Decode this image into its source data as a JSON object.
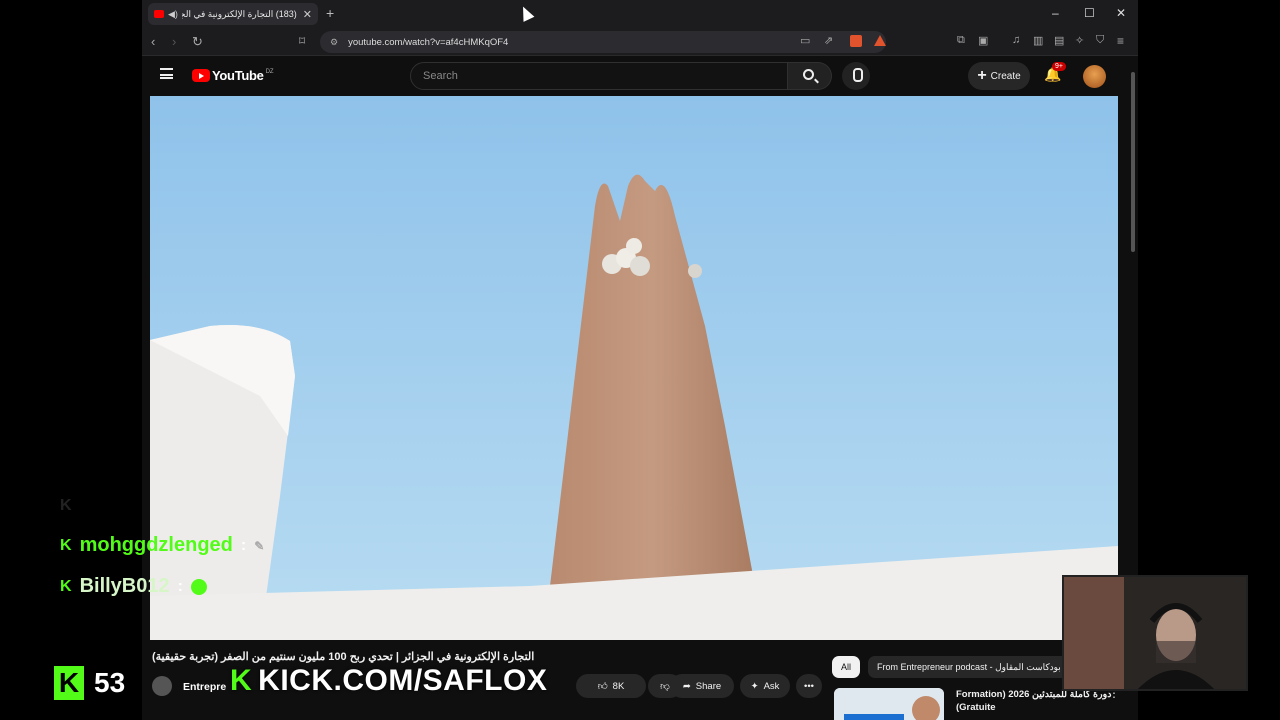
{
  "browser": {
    "tab_title": "(183) التجارة الإلكترونية في الجزائر",
    "url": "youtube.com/watch?v=af4cHMKqOF4"
  },
  "youtube": {
    "logo_text": "YouTube",
    "country_code": "DZ",
    "search_placeholder": "Search",
    "create_label": "Create",
    "notification_count": "9+"
  },
  "video": {
    "title": "التجارة الإلكترونية في الجزائر | تحدي ربح 100 مليون سنتيم من الصفر (تجربة حقيقية)",
    "channel": "Entrepre",
    "likes": "8K",
    "share_label": "Share",
    "ask_label": "Ask"
  },
  "recommendations": {
    "chips": [
      "All",
      "From Entrepreneur podcast - بودكاست المقاول"
    ],
    "item_title": "دورة كاملة للمبتدئين 2026 Formation) (Gratuite"
  },
  "stream_overlay": {
    "chat": [
      {
        "user": "mohggdzlenged",
        "sep": ":"
      },
      {
        "user": "BillyB012",
        "sep": ":"
      }
    ],
    "viewer_count": "53",
    "kick_url": "KICK.COM/SAFLOX"
  },
  "icons": {
    "tab_audio": "speaker-icon",
    "back": "back-arrow-icon",
    "forward": "forward-arrow-icon",
    "reload": "reload-icon",
    "bookmark": "bookmark-icon"
  },
  "colors": {
    "youtube_red": "#ff0000",
    "kick_green": "#53fc18",
    "sky": "#a9d2ee"
  }
}
